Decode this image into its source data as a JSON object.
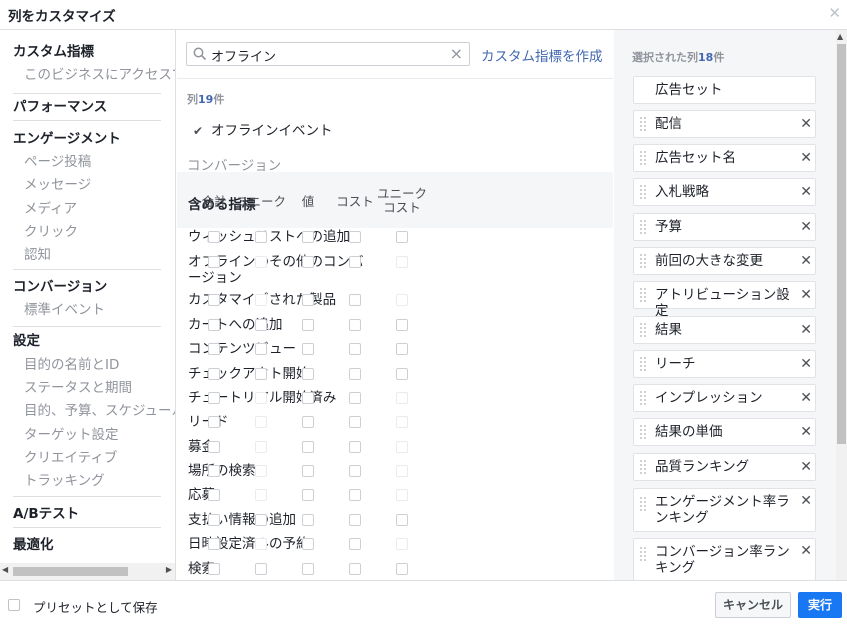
{
  "dialog": {
    "title": "列をカスタマイズ",
    "close_icon": "close-icon"
  },
  "left_nav": [
    {
      "type": "cat",
      "label": "カスタム指標"
    },
    {
      "type": "sub",
      "label": "このビジネスにアクセスで"
    },
    {
      "type": "cat",
      "label": "パフォーマンス"
    },
    {
      "type": "cat",
      "label": "エンゲージメント"
    },
    {
      "type": "sub",
      "label": "ページ投稿"
    },
    {
      "type": "sub",
      "label": "メッセージ"
    },
    {
      "type": "sub",
      "label": "メディア"
    },
    {
      "type": "sub",
      "label": "クリック"
    },
    {
      "type": "sub",
      "label": "認知"
    },
    {
      "type": "cat",
      "label": "コンバージョン"
    },
    {
      "type": "sub",
      "label": "標準イベント"
    },
    {
      "type": "cat",
      "label": "設定"
    },
    {
      "type": "sub",
      "label": "目的の名前とID"
    },
    {
      "type": "sub",
      "label": "ステータスと期間"
    },
    {
      "type": "sub",
      "label": "目的、予算、スケジュール"
    },
    {
      "type": "sub",
      "label": "ターゲット設定"
    },
    {
      "type": "sub",
      "label": "クリエイティブ"
    },
    {
      "type": "sub",
      "label": "トラッキング"
    },
    {
      "type": "cat",
      "label": "A/Bテスト"
    },
    {
      "type": "cat",
      "label": "最適化"
    }
  ],
  "search": {
    "value": "オフライン",
    "icon": "search-icon",
    "clear_icon": "clear-icon"
  },
  "create_link": "カスタム指標を作成",
  "results_count": {
    "prefix": "列",
    "num": "19",
    "suffix": "件"
  },
  "offline_event": {
    "label": "オフラインイベント",
    "checked": true
  },
  "section_label": "コンバージョン",
  "table": {
    "main_header": "含める指標",
    "headers": [
      "合計",
      "ユニーク",
      "値",
      "コスト",
      "ユニーク\nコスト"
    ],
    "rows": [
      {
        "label": "ウィッシュリストへの追加",
        "enabled": [
          true,
          true,
          true,
          true,
          true
        ]
      },
      {
        "label": "オフラインのその他のコンバージョン",
        "enabled": [
          true,
          false,
          true,
          true,
          false
        ]
      },
      {
        "label": "カスタマイズされた製品",
        "enabled": [
          true,
          false,
          true,
          true,
          false
        ]
      },
      {
        "label": "カートへの追加",
        "enabled": [
          true,
          true,
          true,
          true,
          true
        ]
      },
      {
        "label": "コンテンツビュー",
        "enabled": [
          true,
          true,
          true,
          true,
          true
        ]
      },
      {
        "label": "チェックアウト開始",
        "enabled": [
          true,
          true,
          true,
          true,
          true
        ]
      },
      {
        "label": "チュートリアル開始済み",
        "enabled": [
          true,
          false,
          true,
          true,
          false
        ]
      },
      {
        "label": "リード",
        "enabled": [
          true,
          false,
          true,
          true,
          false
        ]
      },
      {
        "label": "募金",
        "enabled": [
          true,
          false,
          true,
          true,
          false
        ]
      },
      {
        "label": "場所の検索",
        "enabled": [
          true,
          false,
          true,
          true,
          false
        ]
      },
      {
        "label": "応募",
        "enabled": [
          true,
          false,
          true,
          true,
          false
        ]
      },
      {
        "label": "支払い情報の追加",
        "enabled": [
          true,
          true,
          true,
          true,
          true
        ]
      },
      {
        "label": "日時設定済みの予約",
        "enabled": [
          true,
          false,
          true,
          true,
          false
        ]
      },
      {
        "label": "検索",
        "enabled": [
          true,
          true,
          true,
          true,
          true
        ]
      }
    ]
  },
  "selected": {
    "title_prefix": "選択された列",
    "count": "18",
    "title_suffix": "件",
    "items": [
      {
        "label": "広告セット",
        "removable": false
      },
      {
        "label": "配信",
        "removable": true
      },
      {
        "label": "広告セット名",
        "removable": true
      },
      {
        "label": "入札戦略",
        "removable": true
      },
      {
        "label": "予算",
        "removable": true
      },
      {
        "label": "前回の大きな変更",
        "removable": true
      },
      {
        "label": "アトリビューション設定",
        "removable": true
      },
      {
        "label": "結果",
        "removable": true
      },
      {
        "label": "リーチ",
        "removable": true
      },
      {
        "label": "インプレッション",
        "removable": true
      },
      {
        "label": "結果の単価",
        "removable": true
      },
      {
        "label": "品質ランキング",
        "removable": true
      },
      {
        "label": "エンゲージメント率ランキング",
        "removable": true
      },
      {
        "label": "コンバージョン率ランキング",
        "removable": true
      }
    ]
  },
  "footer": {
    "preset_label": "プリセットとして保存",
    "cancel_label": "キャンセル",
    "run_label": "実行"
  }
}
